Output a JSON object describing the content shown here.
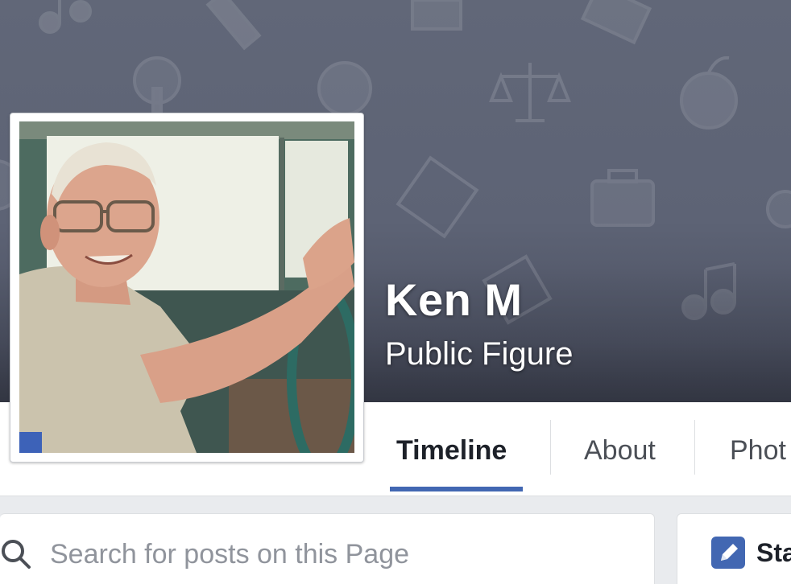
{
  "page": {
    "name": "Ken M",
    "category": "Public Figure"
  },
  "nav": {
    "tabs": [
      {
        "label": "Timeline",
        "active": true
      },
      {
        "label": "About",
        "active": false
      },
      {
        "label": "Phot",
        "active": false
      }
    ]
  },
  "search": {
    "placeholder": "Search for posts on this Page",
    "value": ""
  },
  "composer": {
    "status_label": "Sta"
  },
  "colors": {
    "accent": "#4267b2",
    "cover": "#5d6375",
    "background": "#e9ebee"
  },
  "icons": {
    "search": "search-icon",
    "status": "pencil-icon"
  }
}
